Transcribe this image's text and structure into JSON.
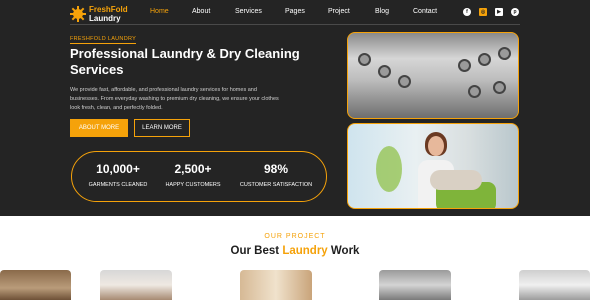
{
  "brand": {
    "name_line1": "FreshFold",
    "name_line2": "Laundry",
    "accent_color": "#f5a20a",
    "dark_bg": "#242424"
  },
  "nav": {
    "items": [
      {
        "label": "Home",
        "active": true
      },
      {
        "label": "About",
        "active": false
      },
      {
        "label": "Services",
        "active": false
      },
      {
        "label": "Pages",
        "active": false
      },
      {
        "label": "Project",
        "active": false
      },
      {
        "label": "Blog",
        "active": false
      },
      {
        "label": "Contact",
        "active": false
      }
    ],
    "socials": [
      "facebook-icon",
      "instagram-icon",
      "youtube-icon",
      "pinterest-icon"
    ]
  },
  "hero": {
    "tag": "FRESHFOLD LAUNDRY",
    "title": "Professional Laundry & Dry Cleaning Services",
    "description": "We provide fast, affordable, and professional laundry services for homes and businesses. From everyday washing to premium dry cleaning, we ensure your clothes look fresh, clean, and perfectly folded.",
    "primary_button": "ABOUT MORE",
    "secondary_button": "LEARN MORE",
    "stats": [
      {
        "value": "10,000+",
        "label": "GARMENTS CLEANED"
      },
      {
        "value": "2,500+",
        "label": "HAPPY CUSTOMERS"
      },
      {
        "value": "98%",
        "label": "CUSTOMER SATISFACTION"
      }
    ]
  },
  "projects": {
    "tag": "OUR PROJECT",
    "title_before": "Our Best",
    "title_highlight": "Laundry",
    "title_after": "Work"
  }
}
